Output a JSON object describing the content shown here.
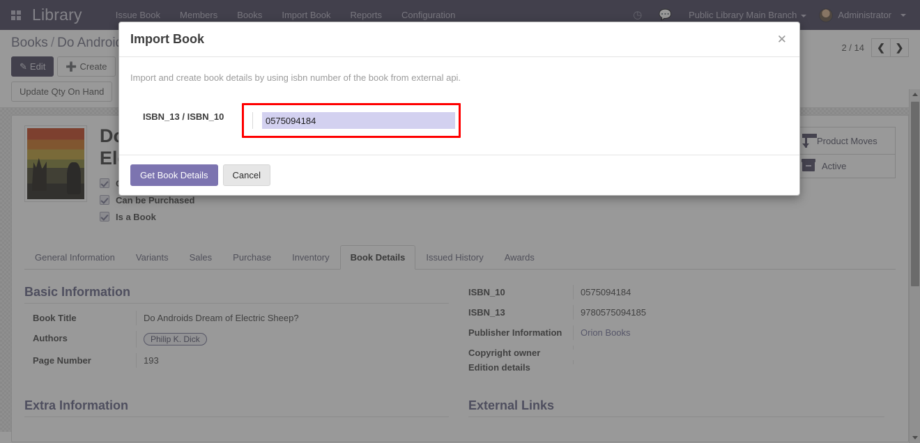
{
  "navbar": {
    "apps_icon": "apps-grid-icon",
    "brand": "Library",
    "menu": [
      "Issue Book",
      "Members",
      "Books",
      "Import Book",
      "Reports",
      "Configuration"
    ],
    "activities_icon": "clock-icon",
    "messages_icon": "chat-icon",
    "company": "Public Library Main Branch",
    "user": "Administrator"
  },
  "control_panel": {
    "breadcrumb_root": "Books",
    "breadcrumb_sep": "/",
    "breadcrumb_current": "Do Android",
    "edit_label": "Edit",
    "create_label": "Create",
    "update_qty_label": "Update Qty On Hand",
    "pager_count": "2 / 14",
    "prev_icon": "chevron-left-icon",
    "next_icon": "chevron-right-icon"
  },
  "record": {
    "title_line1": "Do",
    "title_line2": "Ele",
    "checks": [
      {
        "label": "Ca",
        "checked": true
      },
      {
        "label": "Can be Purchased",
        "checked": true
      },
      {
        "label": "Is a Book",
        "checked": true
      }
    ],
    "stat_buttons": [
      {
        "label": "Product Moves",
        "icon": "up-down-arrows-icon"
      },
      {
        "label": "Active",
        "icon": "archive-box-icon"
      }
    ]
  },
  "tabs": [
    {
      "label": "General Information",
      "active": false
    },
    {
      "label": "Variants",
      "active": false
    },
    {
      "label": "Sales",
      "active": false
    },
    {
      "label": "Purchase",
      "active": false
    },
    {
      "label": "Inventory",
      "active": false
    },
    {
      "label": "Book Details",
      "active": true
    },
    {
      "label": "Issued History",
      "active": false
    },
    {
      "label": "Awards",
      "active": false
    }
  ],
  "basic_information": {
    "title": "Basic Information",
    "fields": [
      {
        "label": "Book Title",
        "value": "Do Androids Dream of Electric Sheep?",
        "type": "text"
      },
      {
        "label": "Authors",
        "value": "Philip K. Dick",
        "type": "tag"
      },
      {
        "label": "Page Number",
        "value": "193",
        "type": "text"
      }
    ]
  },
  "isbn_information": {
    "fields": [
      {
        "label": "ISBN_10",
        "value": "0575094184",
        "type": "text"
      },
      {
        "label": "ISBN_13",
        "value": "9780575094185",
        "type": "text"
      },
      {
        "label": "Publisher Information",
        "value": "Orion Books",
        "type": "link"
      },
      {
        "label": "Copyright owner",
        "value": "",
        "type": "text"
      },
      {
        "label": "Edition details",
        "value": "",
        "type": "text"
      }
    ]
  },
  "extra_information": {
    "title": "Extra Information"
  },
  "external_links": {
    "title": "External Links"
  },
  "modal": {
    "title": "Import Book",
    "close_icon": "close-icon",
    "description": "Import and create book details by using isbn number of the book from external api.",
    "field_label": "ISBN_13 / ISBN_10",
    "field_value": "0575094184",
    "field_placeholder": "",
    "confirm_label": "Get Book Details",
    "cancel_label": "Cancel"
  },
  "colors": {
    "navbar_bg": "#3e3b54",
    "primary_button": "#7c74b0",
    "highlight_border": "#ff0000",
    "input_bg": "#d3d1f0",
    "group_title": "#5a5a7d"
  }
}
